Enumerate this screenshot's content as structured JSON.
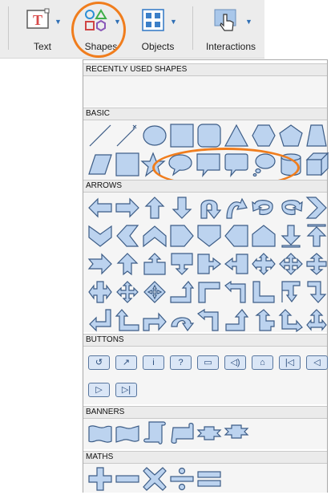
{
  "toolbar": {
    "text_label": "Text",
    "shapes_label": "Shapes",
    "objects_label": "Objects",
    "interactions_label": "Interactions",
    "icons": [
      "text-icon",
      "shapes-icon",
      "objects-icon",
      "interactions-icon"
    ]
  },
  "panel": {
    "sections": {
      "recent": "RECENTLY USED SHAPES",
      "basic": "BASIC",
      "arrows": "ARROWS",
      "buttons": "BUTTONS",
      "banners": "BANNERS",
      "maths": "MATHS"
    },
    "button_glyphs": [
      "↺",
      "↗",
      "i",
      "?",
      "▭",
      "◁)",
      "⌂",
      "|◁",
      "◁",
      "▷",
      "▷|"
    ]
  },
  "colors": {
    "highlight": "#f07d1d",
    "shape_fill": "#bcd3ef",
    "shape_stroke": "#3c5c86",
    "accent": "#2f6fb5"
  }
}
